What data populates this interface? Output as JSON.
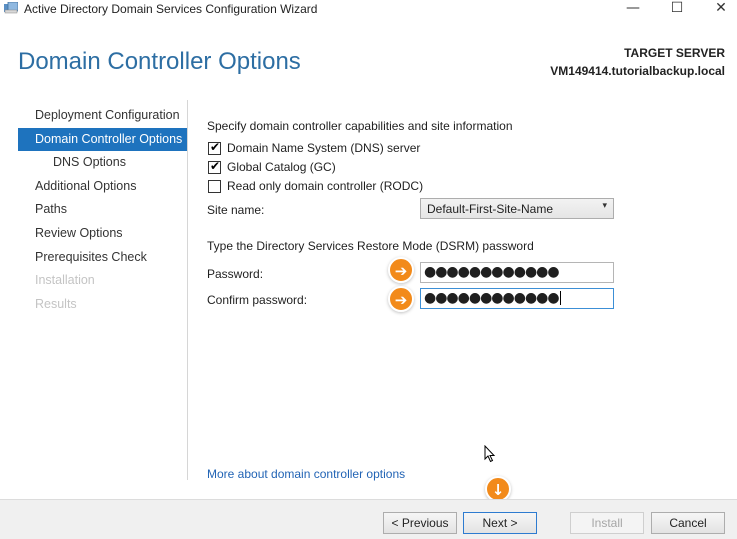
{
  "window": {
    "title": "Active Directory Domain Services Configuration Wizard",
    "minimize_glyph": "—",
    "maximize_glyph": "☐",
    "close_glyph": "✕"
  },
  "header": {
    "page_title": "Domain Controller Options",
    "target_label": "TARGET SERVER",
    "target_value": "VM149414.tutorialbackup.local"
  },
  "nav": {
    "items": [
      {
        "label": "Deployment Configuration",
        "state": "normal"
      },
      {
        "label": "Domain Controller Options",
        "state": "active"
      },
      {
        "label": "DNS Options",
        "state": "sub"
      },
      {
        "label": "Additional Options",
        "state": "normal"
      },
      {
        "label": "Paths",
        "state": "normal"
      },
      {
        "label": "Review Options",
        "state": "normal"
      },
      {
        "label": "Prerequisites Check",
        "state": "normal"
      },
      {
        "label": "Installation",
        "state": "disabled"
      },
      {
        "label": "Results",
        "state": "disabled"
      }
    ]
  },
  "main": {
    "intro": "Specify domain controller capabilities and site information",
    "checkboxes": [
      {
        "label": "Domain Name System (DNS) server",
        "checked": true
      },
      {
        "label": "Global Catalog (GC)",
        "checked": true
      },
      {
        "label": "Read only domain controller (RODC)",
        "checked": false
      }
    ],
    "site_name_label": "Site name:",
    "site_name_value": "Default-First-Site-Name",
    "dsrm_heading": "Type the Directory Services Restore Mode (DSRM) password",
    "password_label": "Password:",
    "password_value": "●●●●●●●●●●●●",
    "confirm_label": "Confirm password:",
    "confirm_value": "●●●●●●●●●●●●",
    "more_link": "More about domain controller options"
  },
  "markers": {
    "arrow_right": "➔",
    "arrow_down": "↓",
    "color": "#f28a1a"
  },
  "footer": {
    "previous": "< Previous",
    "next": "Next >",
    "install": "Install",
    "cancel": "Cancel"
  },
  "icons": {
    "app": "server-manager-icon",
    "check": "✔",
    "dropdown": "▾"
  }
}
